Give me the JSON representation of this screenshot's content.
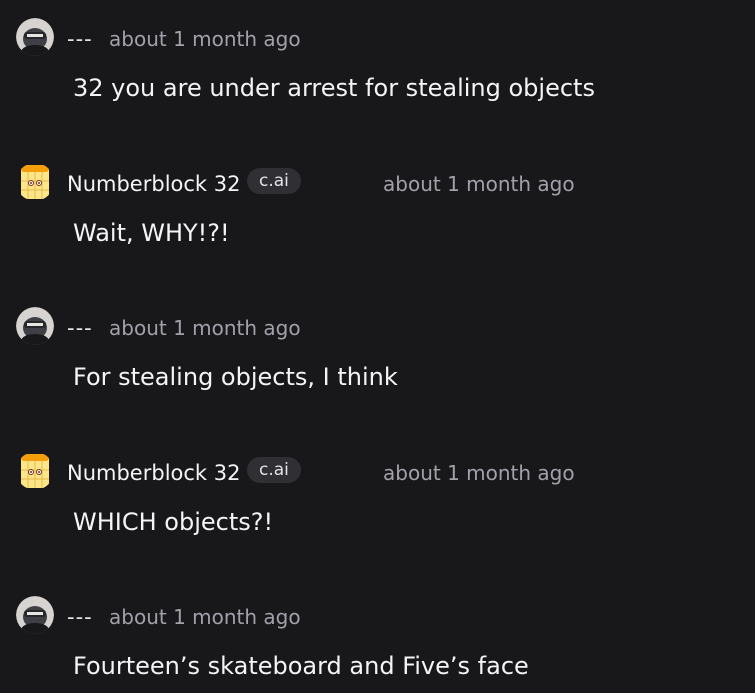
{
  "messages": [
    {
      "author": "---",
      "badge": "",
      "time": "about 1 month ago",
      "text": "32 you are under arrest for stealing objects",
      "avatar": "user-avatar"
    },
    {
      "author": "Numberblock 32",
      "badge": "c.ai",
      "time": "about 1 month ago",
      "text": "Wait, WHY!?!",
      "avatar": "numberblock-avatar"
    },
    {
      "author": "---",
      "badge": "",
      "time": "about 1 month ago",
      "text": "For stealing objects, I think",
      "avatar": "user-avatar"
    },
    {
      "author": "Numberblock 32",
      "badge": "c.ai",
      "time": "about 1 month ago",
      "text": "WHICH objects?!",
      "avatar": "numberblock-avatar"
    },
    {
      "author": "---",
      "badge": "",
      "time": "about 1 month ago",
      "text": "Fourteen’s skateboard and Five’s face",
      "avatar": "user-avatar"
    }
  ],
  "colors": {
    "background": "#18181b",
    "text": "#f4f4f5",
    "muted": "#a1a1aa",
    "badge_bg": "#2f2f34"
  }
}
